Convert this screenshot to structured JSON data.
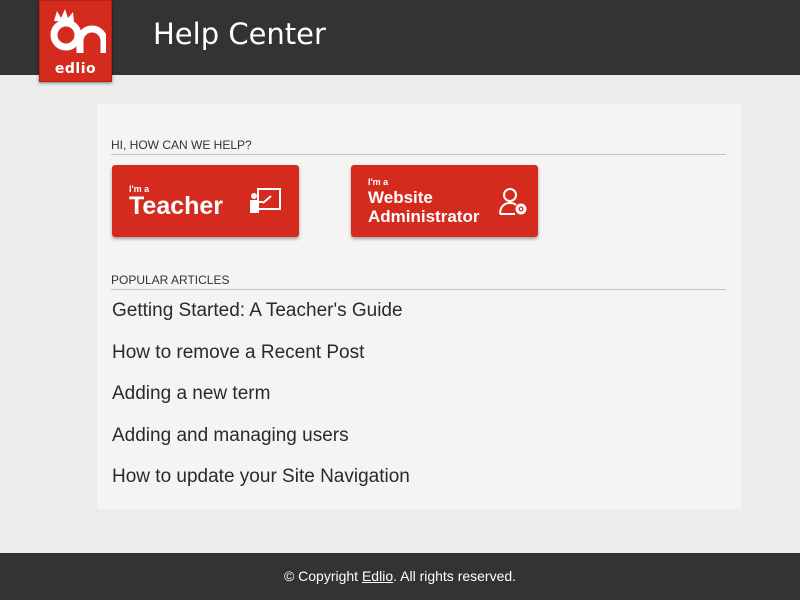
{
  "header": {
    "logo_text": "edlio",
    "title": "Help Center"
  },
  "help_section": {
    "heading": "HI, HOW CAN WE HELP?",
    "roles": [
      {
        "prefix": "I'm a",
        "name": "Teacher",
        "icon": "teacher-board-icon"
      },
      {
        "prefix": "I'm a",
        "name": "Website Administrator",
        "icon": "admin-user-gear-icon"
      }
    ]
  },
  "popular": {
    "heading": "POPULAR ARTICLES",
    "articles": [
      "Getting Started: A Teacher's Guide",
      "How to remove a Recent Post",
      "Adding a new term",
      "Adding and managing users",
      "How to update your Site Navigation"
    ]
  },
  "footer": {
    "prefix": "© Copyright ",
    "link": "Edlio",
    "suffix": ". All rights reserved."
  },
  "colors": {
    "brand_red": "#d52b1e",
    "header_bg": "#333333",
    "page_bg": "#ececec",
    "panel_bg": "#f4f4f4"
  }
}
